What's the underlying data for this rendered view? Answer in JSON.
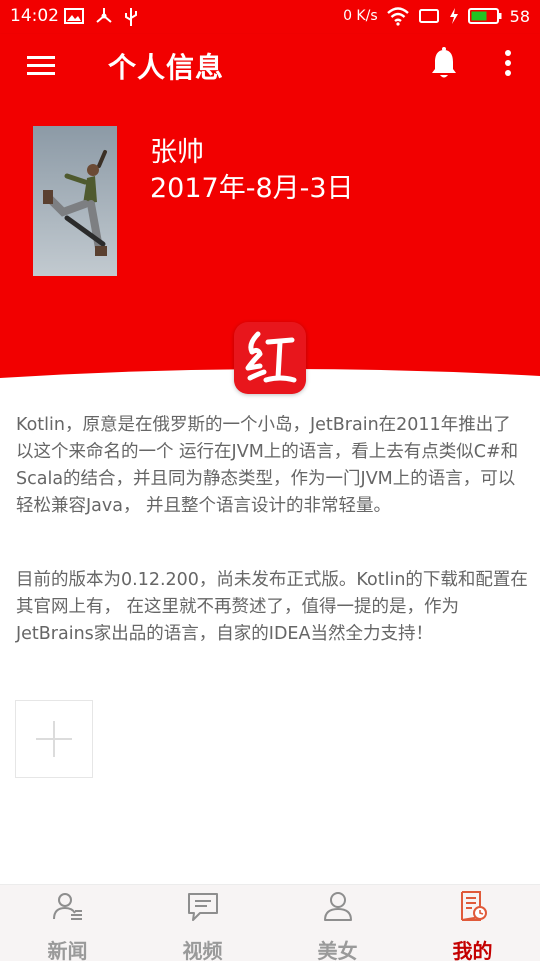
{
  "status_bar": {
    "time": "14:02",
    "network_speed": "0 K/s",
    "battery": "58"
  },
  "toolbar": {
    "title": "个人信息",
    "menu_icon": "hamburger-menu-icon",
    "bell_icon": "bell-icon",
    "more_icon": "more-vertical-icon"
  },
  "profile": {
    "name": "张帅",
    "date": "2017年-8月-3日",
    "logo_char": "红"
  },
  "content": {
    "paragraph1": "Kotlin，原意是在俄罗斯的一个小岛，JetBrain在2011年推出了以这个来命名的一个 运行在JVM上的语言，看上去有点类似C#和Scala的结合，并且同为静态类型，作为一门JVM上的语言，可以轻松兼容Java， 并且整个语言设计的非常轻量。",
    "paragraph2": "目前的版本为0.12.200，尚未发布正式版。Kotlin的下载和配置在其官网上有， 在这里就不再赘述了，值得一提的是，作为JetBrains家出品的语言，自家的IDEA当然全力支持！"
  },
  "bottom_nav": {
    "items": [
      {
        "label": "新闻",
        "icon": "contact-card-icon"
      },
      {
        "label": "视频",
        "icon": "chat-bubble-icon"
      },
      {
        "label": "美女",
        "icon": "person-icon"
      },
      {
        "label": "我的",
        "icon": "document-clock-icon"
      }
    ],
    "active_index": 3
  },
  "colors": {
    "primary": "#f20000",
    "active_tab": "#c40000",
    "inactive_tab": "#9a9a9a",
    "body_text": "#666666"
  }
}
